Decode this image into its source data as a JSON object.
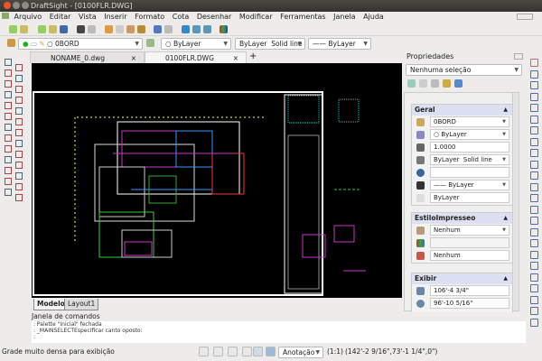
{
  "window": {
    "title": "DraftSight - [0100FLR.DWG]"
  },
  "menu": [
    "Arquivo",
    "Editar",
    "Vista",
    "Inserir",
    "Formato",
    "Cota",
    "Desenhar",
    "Modificar",
    "Ferramentas",
    "Janela",
    "Ajuda"
  ],
  "layer_toolbar": {
    "layer": "0BORD",
    "color": "ByLayer",
    "linetype_a": "ByLayer",
    "linetype_b": "Solid line",
    "lineweight": "—— ByLayer"
  },
  "doc_tabs": [
    {
      "label": "NONAME_0.dwg"
    },
    {
      "label": "0100FLR.DWG",
      "active": true
    }
  ],
  "tab_close": "×",
  "tab_add": "+",
  "model_tabs": [
    "Modelo",
    "Layout1"
  ],
  "command_window": {
    "title": "Janela de comandos",
    "lines": [
      ": Palette \"Inicial\" fechada",
      ": _MAINSELECTEspecificar canto oposto:",
      ":"
    ]
  },
  "status": {
    "message": "Grade muito densa para exibição",
    "annotation": "Anotação",
    "scale": "(1:1)",
    "coords": "(142'-2 9/16\",73'-1 1/4\",0\")"
  },
  "properties": {
    "title": "Propriedades",
    "selection": "Nenhuma seleção",
    "sections": {
      "general": {
        "title": "Geral",
        "layer": "0BORD",
        "color": "○ ByLayer",
        "scale": "1.0000",
        "linetype_a": "ByLayer",
        "linetype_b": "Solid line",
        "hyperlink": "",
        "lineweight": "—— ByLayer",
        "transparency": "ByLayer"
      },
      "print_style": {
        "title": "EstiloImpresseo",
        "style": "Nenhum",
        "table": "",
        "table_type": "Nenhum"
      },
      "display": {
        "title": "Exibir",
        "height": "106'-4 3/4\"",
        "width": "96'-10 5/16\""
      }
    }
  },
  "colors": {
    "canvas": "#000000",
    "titlebar": "#3c3b37",
    "section_header": "#dde0f3"
  }
}
